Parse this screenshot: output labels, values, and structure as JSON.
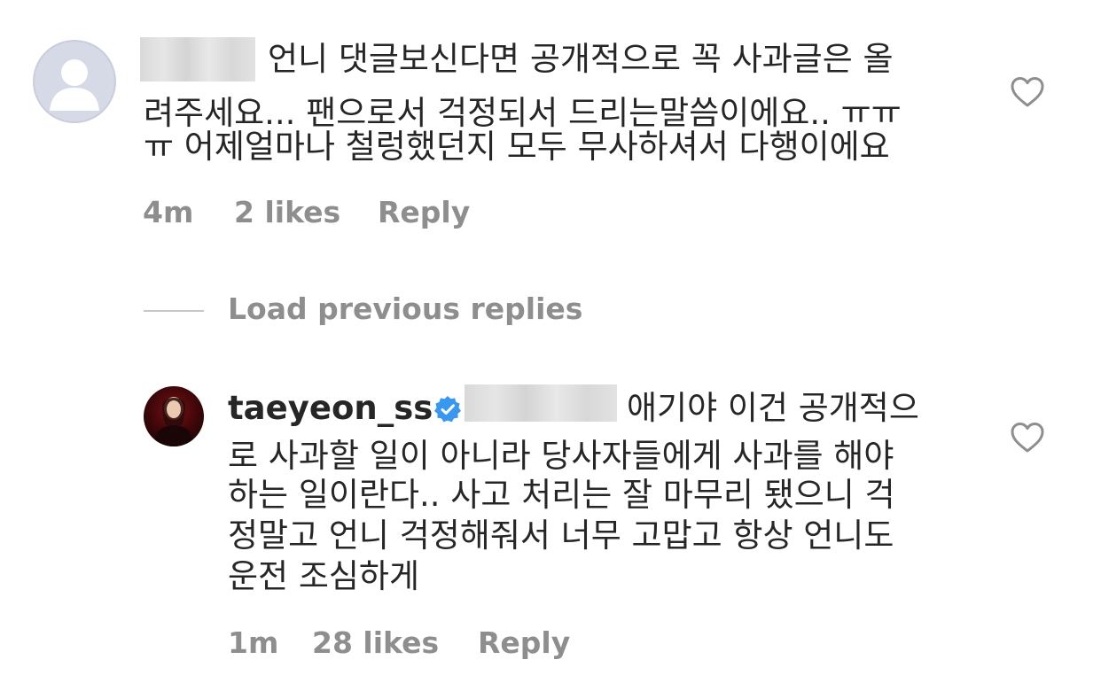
{
  "comment1": {
    "lines": [
      "언니 댓글보신다면 공개적으로 꼭 사과글은 올",
      "려주세요... 팬으로서 걱정되서 드리는말씀이에요.. ㅠㅠ",
      "ㅠ 어제얼마나 철렁했던지 모두 무사하셔서 다행이에요"
    ],
    "time": "4m",
    "likes": "2 likes",
    "reply": "Reply",
    "avatar_icon": "default-profile-icon",
    "like_icon": "heart-outline-icon"
  },
  "load_previous": "Load previous replies",
  "comment2": {
    "username": "taeyeon_ss",
    "verified_icon": "verified-badge-icon",
    "lines": [
      "애기야 이건 공개적으",
      "로 사과할 일이 아니라 당사자들에게 사과를 해야",
      "하는 일이란다.. 사고 처리는 잘 마무리 됐으니 걱",
      "정말고 언니 걱정해줘서 너무 고맙고 항상 언니도",
      "운전 조심하게"
    ],
    "time": "1m",
    "likes": "28 likes",
    "reply": "Reply",
    "like_icon": "heart-outline-icon"
  },
  "colors": {
    "text": "#262626",
    "meta": "#8e8e8e",
    "verified": "#3897f0",
    "divider": "#c7c7c7"
  }
}
